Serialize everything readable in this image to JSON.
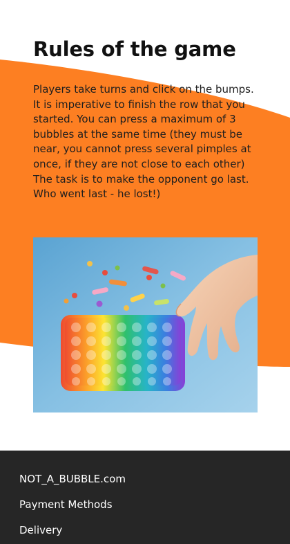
{
  "section": {
    "title": "Rules of the game",
    "rules_text": "Players take turns and click on the bumps. It is imperative to finish the row that you started. You can press a maximum of 3 bubbles at the same time (they must be near, you cannot press several pimples at once, if they are not close to each other) The task is to make the opponent go last. Who went last - he lost!)"
  },
  "colors": {
    "accent": "#fd7f22",
    "footer_bg": "#262626",
    "photo_bg": "#7fb8dc"
  },
  "footer": {
    "links": [
      {
        "label": "NOT_A_BUBBLE.com"
      },
      {
        "label": "Payment Methods"
      },
      {
        "label": "Delivery"
      }
    ]
  }
}
